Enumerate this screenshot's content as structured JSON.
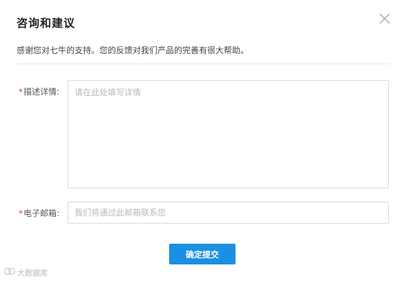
{
  "dialog": {
    "title": "咨询和建议",
    "close_icon": "close-icon",
    "subtitle": "感谢您对七牛的支持。您的反馈对我们产品的完善有很大帮助。"
  },
  "form": {
    "description": {
      "required_mark": "*",
      "label": "描述详情:",
      "placeholder": "请在此处填写详情",
      "value": ""
    },
    "email": {
      "required_mark": "*",
      "label": "电子邮箱:",
      "placeholder": "我们将通过此邮箱联系您",
      "value": ""
    },
    "submit_label": "确定提交"
  },
  "watermark": {
    "text": "大数据库"
  },
  "colors": {
    "accent": "#1a8fe3",
    "required": "#e4393c",
    "border": "#d9d9d9"
  }
}
